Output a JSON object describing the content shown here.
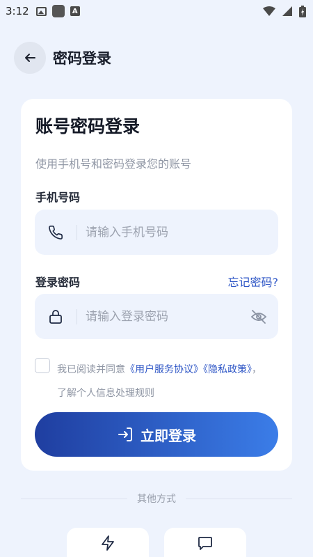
{
  "status_bar": {
    "time": "3:12"
  },
  "header": {
    "title": "密码登录"
  },
  "card": {
    "title": "账号密码登录",
    "subtitle": "使用手机号和密码登录您的账号",
    "phone": {
      "label": "手机号码",
      "placeholder": "请输入手机号码",
      "value": ""
    },
    "password": {
      "label": "登录密码",
      "placeholder": "请输入登录密码",
      "value": "",
      "forgot_label": "忘记密码?"
    },
    "agreement": {
      "checked": false,
      "prefix": "我已阅读并同意",
      "user_agreement": "《用户服务协议》",
      "privacy_policy": "《隐私政策》",
      "suffix": "，了解个人信息处理规则"
    },
    "login_button": {
      "label": "立即登录"
    }
  },
  "other_methods": {
    "label": "其他方式",
    "items": [
      {
        "icon": "lightning-icon"
      },
      {
        "icon": "message-icon"
      }
    ]
  },
  "colors": {
    "background": "#eef3fd",
    "accent": "#2e56c6",
    "button_gradient_start": "#1f3ea0",
    "button_gradient_end": "#3b7de8"
  }
}
